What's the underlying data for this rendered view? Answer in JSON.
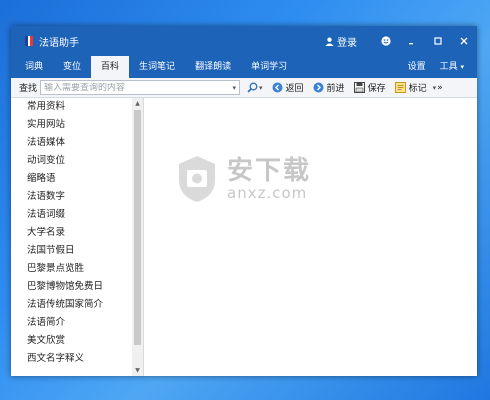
{
  "window": {
    "title": "法语助手",
    "login_label": "登录"
  },
  "tabs": [
    {
      "label": "词典",
      "active": false
    },
    {
      "label": "变位",
      "active": false
    },
    {
      "label": "百科",
      "active": true
    },
    {
      "label": "生词笔记",
      "active": false
    },
    {
      "label": "翻译朗读",
      "active": false
    },
    {
      "label": "单词学习",
      "active": false
    }
  ],
  "tab_right": {
    "settings": "设置",
    "tools": "工具"
  },
  "toolbar": {
    "search_label": "查找",
    "search_placeholder": "输入需要查询的内容",
    "back": "返回",
    "forward": "前进",
    "save": "保存",
    "mark": "标记",
    "overflow": "»"
  },
  "sidebar": {
    "items": [
      "常用资料",
      "实用网站",
      "法语媒体",
      "动词变位",
      "缩略语",
      "法语数字",
      "法语词缀",
      "大学名录",
      "法国节假日",
      "巴黎景点览胜",
      "巴黎博物馆免费日",
      "法语传统国家简介",
      "法语简介",
      "美文欣赏",
      "西文名字释义"
    ]
  },
  "watermark": {
    "cn": "安下载",
    "url": "anxz.com"
  },
  "colors": {
    "titlebar": "#1d63b8",
    "desktop": "#2e8df0",
    "flag_blue": "#1b3fa0",
    "flag_white": "#ffffff",
    "flag_red": "#e23a3a"
  }
}
